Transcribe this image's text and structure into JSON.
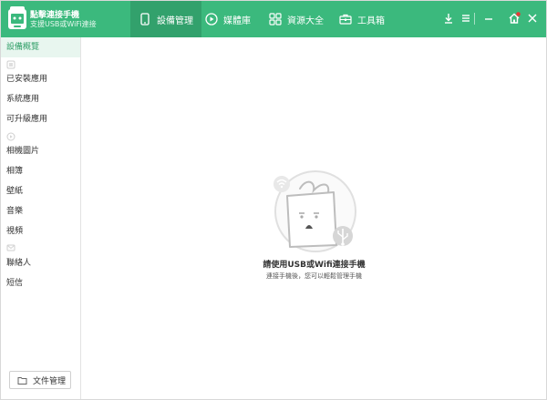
{
  "app": {
    "title": "點擊連接手機",
    "subtitle": "支援USB或WiFi連接"
  },
  "tabs": [
    {
      "label": "設備管理",
      "icon": "phone-icon",
      "active": true
    },
    {
      "label": "媒體庫",
      "icon": "play-circle-icon",
      "active": false
    },
    {
      "label": "資源大全",
      "icon": "grid-icon",
      "active": false
    },
    {
      "label": "工具箱",
      "icon": "toolbox-icon",
      "active": false
    }
  ],
  "window_controls": [
    "download-icon",
    "menu-icon",
    "minimize-icon",
    "home-icon",
    "close-icon"
  ],
  "colors": {
    "brand": "#3bb97d",
    "brand_active": "#32a16c",
    "notify_dot": "#e53935",
    "sidebar_active_bg": "#e8f6ef",
    "sidebar_active_text": "#2e9e66"
  },
  "sidebar": {
    "items": [
      {
        "label": "設備概覽",
        "active": true
      },
      {
        "label": "已安裝應用"
      },
      {
        "label": "系統應用"
      },
      {
        "label": "可升級應用"
      },
      {
        "label": "相機圖片"
      },
      {
        "label": "相簿"
      },
      {
        "label": "壁紙"
      },
      {
        "label": "音樂"
      },
      {
        "label": "視頻"
      },
      {
        "label": "聯絡人"
      },
      {
        "label": "短信"
      }
    ],
    "section_icons": [
      "apps-section-icon",
      "media-section-icon",
      "messages-section-icon"
    ],
    "file_manager_label": "文件管理"
  },
  "main": {
    "empty_title": "請使用USB或Wifi連接手機",
    "empty_subtitle": "連接手機後，您可以輕鬆管理手機"
  }
}
